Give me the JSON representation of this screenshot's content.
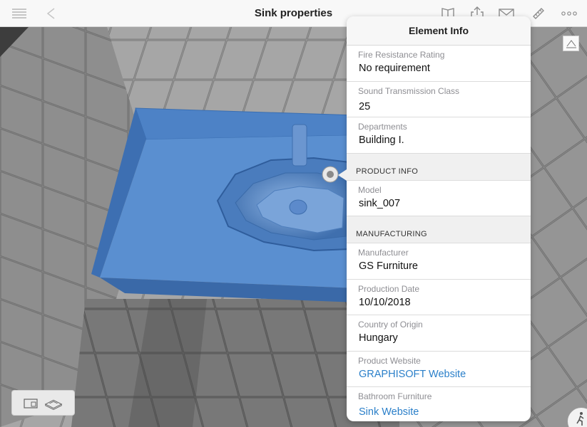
{
  "toolbar": {
    "title": "Sink properties",
    "icons": [
      "list-icon",
      "back-icon",
      "book-icon",
      "share-icon",
      "mail-icon",
      "measure-icon",
      "more-icon"
    ]
  },
  "panel": {
    "title": "Element Info",
    "rows_top": [
      {
        "label": "Fire Resistance Rating",
        "value": "No requirement"
      },
      {
        "label": "Sound Transmission Class",
        "value": "25"
      },
      {
        "label": "Departments",
        "value": "Building I."
      }
    ],
    "product_info": {
      "heading": "PRODUCT INFO",
      "rows": [
        {
          "label": "Model",
          "value": "sink_007"
        }
      ]
    },
    "manufacturing": {
      "heading": "MANUFACTURING",
      "rows": [
        {
          "label": "Manufacturer",
          "value": "GS Furniture"
        },
        {
          "label": "Production Date",
          "value": "10/10/2018"
        },
        {
          "label": "Country of Origin",
          "value": "Hungary"
        },
        {
          "label": "Product Website",
          "value": "GRAPHISOFT Website",
          "link": true
        },
        {
          "label": "Bathroom Furniture",
          "value": "Sink Website",
          "link": true
        }
      ]
    }
  },
  "colors": {
    "accent_link": "#2a7fc9",
    "sink_blue": "#4f86c9",
    "tile_gray": "#8a8a8a"
  },
  "view_switcher": [
    "plan-view-icon",
    "3d-view-icon"
  ]
}
